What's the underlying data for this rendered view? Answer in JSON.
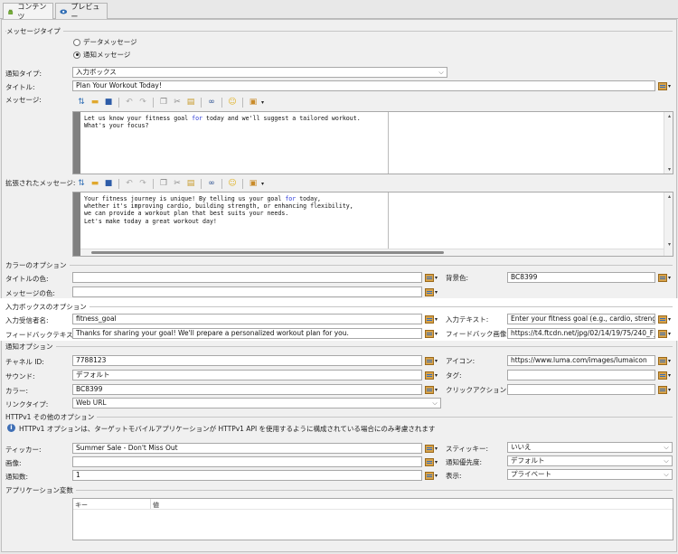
{
  "tabs": [
    {
      "label": "コンテンツ",
      "icon": "android-icon",
      "active": true
    },
    {
      "label": "プレビュー",
      "icon": "eye-icon",
      "active": false
    }
  ],
  "message_type": {
    "title": "メッセージタイプ",
    "options": [
      "データメッセージ",
      "通知メッセージ"
    ],
    "selected": "通知メッセージ"
  },
  "notification_type": {
    "label": "通知タイプ:",
    "value": "入力ボックス"
  },
  "title_field": {
    "label": "タイトル:",
    "value": "Plan Your Workout Today!"
  },
  "message": {
    "label": "メッセージ:",
    "lines": [
      "Let us know your fitness goal for today and we'll suggest a tailored workout.",
      "What's your focus?"
    ]
  },
  "extended_message": {
    "label": "拡張されたメッセージ:",
    "lines": [
      "Your fitness journey is unique! By telling us your goal for today,",
      "whether it's improving cardio, building strength, or enhancing flexibility,",
      "we can provide a workout plan that best suits your needs.",
      "Let's make today a great workout day!"
    ]
  },
  "color_options": {
    "title": "カラーのオプション",
    "title_color_label": "タイトルの色:",
    "title_color_value": "",
    "message_color_label": "メッセージの色:",
    "message_color_value": "",
    "background_color_label": "背景色:",
    "background_color_value": "BC8399"
  },
  "input_box": {
    "title": "入力ボックスのオプション",
    "receiver_label": "入力受信者名:",
    "receiver_value": "fitness_goal",
    "feedback_text_label": "フィードバックテキスト:",
    "feedback_text_value": "Thanks for sharing your goal! We'll prepare a personalized workout plan for you.",
    "input_text_label": "入力テキスト:",
    "input_text_value": "Enter your fitness goal (e.g., cardio, strength, flex",
    "feedback_image_label": "フィードバック画像:",
    "feedback_image_value": "https://t4.ftcdn.net/jpg/02/14/19/75/240_F_21419"
  },
  "notification_options": {
    "title": "通知オプション",
    "channel_id_label": "チャネル ID:",
    "channel_id_value": "7788123",
    "sound_label": "サウンド:",
    "sound_value": "デフォルト",
    "color_label": "カラー:",
    "color_value": "BC8399",
    "link_type_label": "リンクタイプ:",
    "link_type_value": "Web URL",
    "icon_label": "アイコン:",
    "icon_value": "https://www.luma.com/images/lumaicon",
    "tag_label": "タグ:",
    "tag_value": "",
    "click_action_label": "クリックアクション:",
    "click_action_value": ""
  },
  "http_v1": {
    "title": "HTTPv1 その他のオプション",
    "info": "HTTPv1 オプションは、ターゲットモバイルアプリケーションが HTTPv1 API を使用するように構成されている場合にのみ考慮されます",
    "ticker_label": "ティッカー:",
    "ticker_value": "Summer Sale - Don't Miss Out",
    "image_label": "画像:",
    "image_value": "",
    "count_label": "通知数:",
    "count_value": "1",
    "sticky_label": "スティッキー:",
    "sticky_value": "いいえ",
    "priority_label": "通知優先度:",
    "priority_value": "デフォルト",
    "visibility_label": "表示:",
    "visibility_value": "プライベート"
  },
  "app_variables": {
    "title": "アプリケーション変数",
    "col_key": "キー",
    "col_value": "値"
  }
}
